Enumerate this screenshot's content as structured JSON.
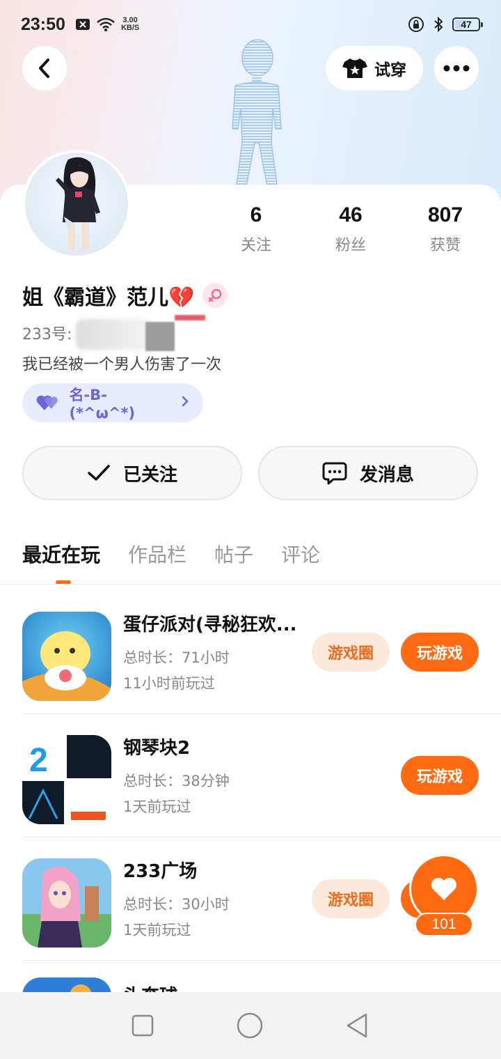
{
  "status_bar": {
    "time": "23:50",
    "net_speed_value": "3.00",
    "net_speed_unit": "KB/S",
    "battery": "47",
    "battery_level_percent": 47,
    "icons": [
      "notification-x-icon",
      "wifi-icon",
      "rotation-lock-icon",
      "bluetooth-icon",
      "battery-icon"
    ]
  },
  "header": {
    "back_icon": "chevron-left-icon",
    "tryon_label": "试穿",
    "tryon_icon": "tshirt-icon",
    "more_icon": "more-dots-icon"
  },
  "profile": {
    "stats": [
      {
        "value": "6",
        "label": "关注"
      },
      {
        "value": "46",
        "label": "粉丝"
      },
      {
        "value": "807",
        "label": "获赞"
      }
    ],
    "nickname": "姐《霸道》范儿💔",
    "gender": "female",
    "uid_label": "233号:",
    "bio": "我已经被一个男人伤害了一次",
    "tag": "名-B-(*^ω^*)",
    "tag_icon": "heart-pair-icon",
    "colors": {
      "accent": "#ff6b12",
      "tag_bg": "#e9ecff",
      "tag_text": "#6b66d8"
    }
  },
  "actions": {
    "follow_label": "已关注",
    "message_label": "发消息"
  },
  "tabs": [
    {
      "label": "最近在玩",
      "active": true
    },
    {
      "label": "作品栏",
      "active": false
    },
    {
      "label": "帖子",
      "active": false
    },
    {
      "label": "评论",
      "active": false
    }
  ],
  "games": [
    {
      "title": "蛋仔派对(寻秘狂欢...",
      "duration": "总时长：71小时",
      "last_played": "11小时前玩过",
      "circle_label": "游戏圈",
      "play_label": "玩游戏"
    },
    {
      "title": "钢琴块2",
      "duration": "总时长：38分钟",
      "last_played": "1天前玩过",
      "play_label": "玩游戏"
    },
    {
      "title": "233广场",
      "duration": "总时长：30小时",
      "last_played": "1天前玩过",
      "circle_label": "游戏圈"
    },
    {
      "title": "头奔球"
    }
  ],
  "like_float": {
    "count": "101",
    "icon": "heart-icon"
  },
  "nav_bar": {
    "icons": [
      "recents-square-icon",
      "home-circle-icon",
      "back-triangle-icon"
    ]
  }
}
